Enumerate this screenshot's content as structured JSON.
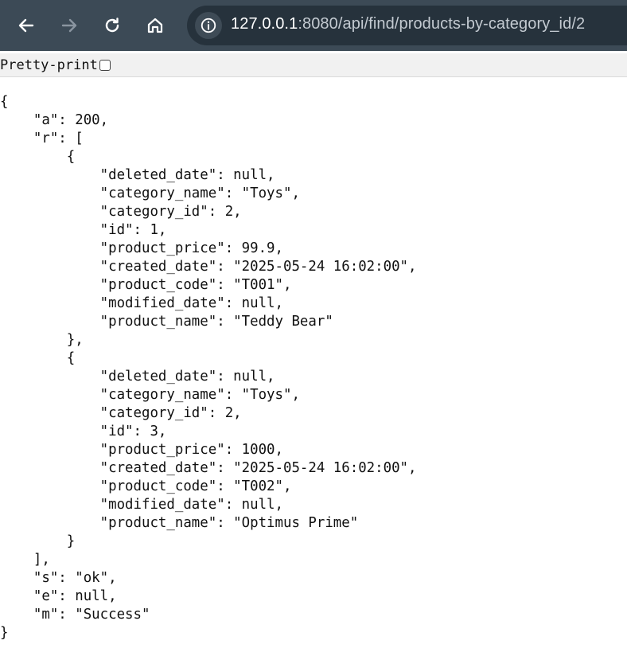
{
  "nav": {
    "back_icon": "arrow-left-icon",
    "forward_icon": "arrow-right-icon",
    "reload_icon": "reload-icon",
    "home_icon": "home-icon",
    "info_icon": "info-icon"
  },
  "address_bar": {
    "host": "127.0.0.1",
    "rest": ":8080/api/find/products-by-category_id/2"
  },
  "pretty_print": {
    "label": "Pretty-print",
    "checked": false
  },
  "json_text": "{\n    \"a\": 200,\n    \"r\": [\n        {\n            \"deleted_date\": null,\n            \"category_name\": \"Toys\",\n            \"category_id\": 2,\n            \"id\": 1,\n            \"product_price\": 99.9,\n            \"created_date\": \"2025-05-24 16:02:00\",\n            \"product_code\": \"T001\",\n            \"modified_date\": null,\n            \"product_name\": \"Teddy Bear\"\n        },\n        {\n            \"deleted_date\": null,\n            \"category_name\": \"Toys\",\n            \"category_id\": 2,\n            \"id\": 3,\n            \"product_price\": 1000,\n            \"created_date\": \"2025-05-24 16:02:00\",\n            \"product_code\": \"T002\",\n            \"modified_date\": null,\n            \"product_name\": \"Optimus Prime\"\n        }\n    ],\n    \"s\": \"ok\",\n    \"e\": null,\n    \"m\": \"Success\"\n}",
  "colors": {
    "toolbar": "#3c4a56",
    "omnibox": "#26323c"
  }
}
